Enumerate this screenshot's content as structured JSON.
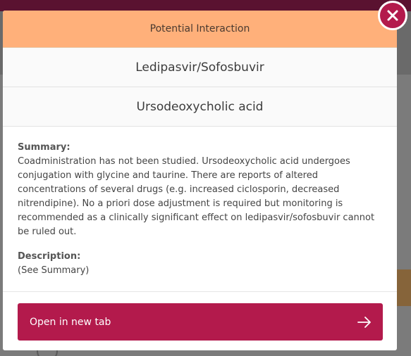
{
  "modal": {
    "header_title": "Potential Interaction",
    "drug_a": "Ledipasvir/Sofosbuvir",
    "drug_b": "Ursodeoxycholic acid",
    "summary_label": "Summary:",
    "summary_text": "Coadministration has not been studied. Ursodeoxycholic acid undergoes conjugation with glycine and taurine. There are reports of altered concentrations of several drugs (e.g. increased ciclosporin, decreased nitrendipine). No a priori dose adjustment is required but monitoring is recommended as a clinically significant effect on ledipasvir/sofosbuvir cannot be ruled out.",
    "description_label": "Description:",
    "description_text": "(See Summary)",
    "open_button_label": "Open in new tab",
    "open_button_icon": "arrow-right-icon",
    "close_icon": "close-icon"
  },
  "colors": {
    "header_bg": "#ffb07a",
    "accent": "#b31a4c"
  }
}
